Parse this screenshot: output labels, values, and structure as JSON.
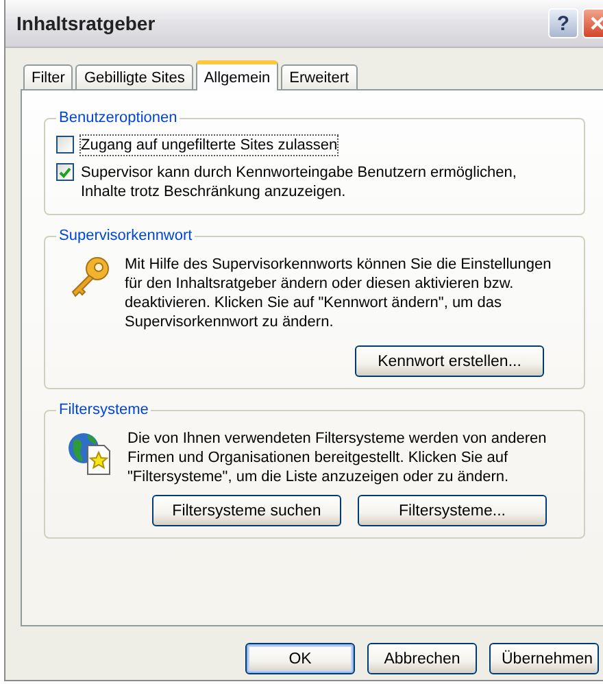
{
  "window": {
    "title": "Inhaltsratgeber"
  },
  "title_buttons": [
    {
      "kind": "help",
      "label": "?"
    },
    {
      "kind": "close"
    }
  ],
  "tabs": [
    {
      "label": "Filter",
      "selected": false
    },
    {
      "label": "Gebilligte Sites",
      "selected": false
    },
    {
      "label": "Allgemein",
      "selected": true
    },
    {
      "label": "Erweitert",
      "selected": false
    }
  ],
  "groups": [
    {
      "title": "Benutzeroptionen",
      "kind": "options",
      "options": [
        {
          "label": "Zugang auf ungefilterte Sites zulassen",
          "checked": false,
          "focused": true
        },
        {
          "label": "Supervisor kann durch Kennworteingabe Benutzern ermöglichen, Inhalte trotz Beschränkung anzuzeigen.",
          "checked": true,
          "focused": false
        }
      ]
    },
    {
      "title": "Supervisorkennwort",
      "kind": "password",
      "text": "Mit Hilfe des Supervisorkennworts können Sie die Einstellungen für den Inhaltsratgeber ändern oder diesen aktivieren bzw. deaktivieren. Klicken Sie auf \"Kennwort ändern\", um das Supervisorkennwort zu ändern.",
      "buttons": [
        {
          "label": "Kennwort erstellen..."
        }
      ]
    },
    {
      "title": "Filtersysteme",
      "kind": "filters",
      "text": "Die von Ihnen verwendeten Filtersysteme werden von anderen Firmen und Organisationen bereitgestellt. Klicken Sie auf \"Filtersysteme\", um die Liste anzuzeigen oder zu ändern.",
      "buttons": [
        {
          "label": "Filtersysteme suchen"
        },
        {
          "label": "Filtersysteme..."
        }
      ]
    }
  ],
  "buttons": [
    {
      "label": "OK",
      "default": true
    },
    {
      "label": "Abbrechen",
      "default": false
    },
    {
      "label": "Übernehmen",
      "default": false
    }
  ]
}
